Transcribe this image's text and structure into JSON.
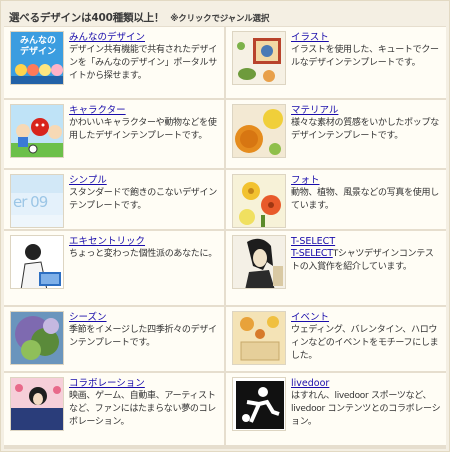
{
  "header": {
    "title": "選べるデザインは400種類以上！",
    "note": "※クリックでジャンル選択"
  },
  "categories": [
    {
      "title": "みんなのデザイン",
      "desc": "デザイン共有機能で共有されたデザインを「みんなのデザイン」ポータルサイトから探せます。",
      "thumb_text": "みんなの デザイン",
      "icon": "community-design-icon"
    },
    {
      "title": "イラスト",
      "desc": "イラストを使用した、キュートでクールなデザインテンプレートです。",
      "icon": "illustration-icon"
    },
    {
      "title": "キャラクター",
      "desc": "かわいいキャラクターや動物などを使用したデザインテンプレートです。",
      "icon": "character-icon"
    },
    {
      "title": "マテリアル",
      "desc": "様々な素材の質感をいかしたポップなデザインテンプレートです。",
      "icon": "material-icon"
    },
    {
      "title": "シンプル",
      "desc": "スタンダードで飽きのこないデザインテンプレートです。",
      "thumb_text": "er 09",
      "icon": "simple-icon"
    },
    {
      "title": "フォト",
      "desc": "動物、植物、風景などの写真を使用しています。",
      "icon": "photo-icon"
    },
    {
      "title": "エキセントリック",
      "desc": "ちょっと変わった個性派のあなたに。",
      "icon": "eccentric-icon"
    },
    {
      "title": "T-SELECT",
      "title2": "T-SELECT",
      "desc": "Tシャツデザインコンテストの入賞作を紹介しています。",
      "icon": "t-select-icon"
    },
    {
      "title": "シーズン",
      "desc": "季節をイメージした四季折々のデザインテンプレートです。",
      "icon": "season-icon"
    },
    {
      "title": "イベント",
      "desc": "ウェディング、バレンタイン、ハロウィンなどのイベントをモチーフにしました。",
      "icon": "event-icon"
    },
    {
      "title": "コラボレーション",
      "desc": "映画、ゲーム、自動車、アーティストなど、ファンにはたまらない夢のコレボレーション。",
      "icon": "collaboration-icon"
    },
    {
      "title": "livedoor",
      "desc": "はすれん、livedoor スポーツなど、livedoor コンテンツとのコラボレーション。",
      "icon": "livedoor-icon"
    }
  ],
  "colors": {
    "link": "#1a0dab",
    "cell_bg": "#fffdf5",
    "frame_bg": "#f4efe3"
  }
}
